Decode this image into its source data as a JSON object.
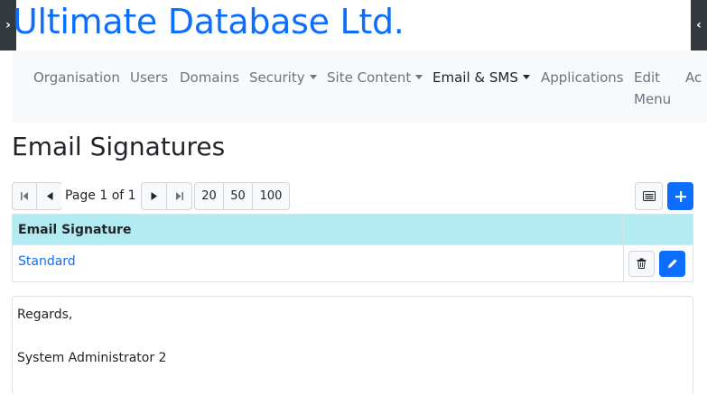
{
  "app": {
    "brand": "Ultimate Database Ltd."
  },
  "nav": {
    "items": [
      {
        "label": "Organisation"
      },
      {
        "label": "Users"
      },
      {
        "label": "Domains"
      },
      {
        "label": "Security"
      },
      {
        "label": "Site Content"
      },
      {
        "label": "Email & SMS"
      },
      {
        "label": "Applications"
      },
      {
        "label": "Edit"
      },
      {
        "label": "Menu"
      },
      {
        "label": "Ac"
      }
    ],
    "active": "Email & SMS"
  },
  "page": {
    "title": "Email Signatures"
  },
  "pager": {
    "text": "Page 1 of 1",
    "sizes": [
      "20",
      "50",
      "100"
    ]
  },
  "table": {
    "columns": [
      "Email Signature"
    ],
    "rows": [
      {
        "name": "Standard"
      }
    ]
  },
  "preview": {
    "lines": [
      "Regards,",
      "",
      "System Administrator 2"
    ]
  },
  "colors": {
    "primary": "#0d6efd",
    "header_bg": "#b3ebf2",
    "nav_bg": "#f8f9fa"
  },
  "icons": [
    "chevron-right-icon",
    "chevron-left-icon",
    "first-page-icon",
    "prev-page-icon",
    "next-page-icon",
    "last-page-icon",
    "list-view-icon",
    "plus-icon",
    "trash-icon",
    "pencil-icon",
    "caret-down-icon"
  ]
}
